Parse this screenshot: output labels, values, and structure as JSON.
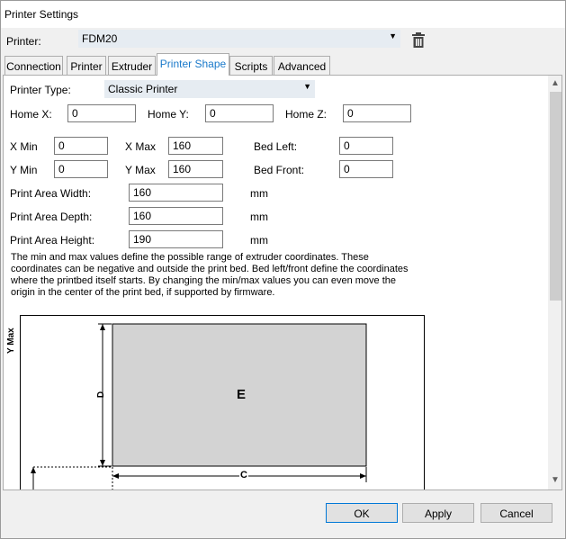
{
  "window": {
    "title": "Printer Settings"
  },
  "printer": {
    "label": "Printer:",
    "value": "FDM20"
  },
  "tabs": [
    "Connection",
    "Printer",
    "Extruder",
    "Printer Shape",
    "Scripts",
    "Advanced"
  ],
  "active_tab": "Printer Shape",
  "shape": {
    "printer_type_label": "Printer Type:",
    "printer_type_value": "Classic Printer",
    "home_x_label": "Home X:",
    "home_x": "0",
    "home_y_label": "Home Y:",
    "home_y": "0",
    "home_z_label": "Home Z:",
    "home_z": "0",
    "x_min_label": "X Min",
    "x_min": "0",
    "x_max_label": "X Max",
    "x_max": "160",
    "bed_left_label": "Bed Left:",
    "bed_left": "0",
    "y_min_label": "Y Min",
    "y_min": "0",
    "y_max_label": "Y Max",
    "y_max": "160",
    "bed_front_label": "Bed Front:",
    "bed_front": "0",
    "width_label": "Print Area Width:",
    "width": "160",
    "width_unit": "mm",
    "depth_label": "Print Area Depth:",
    "depth": "160",
    "depth_unit": "mm",
    "height_label": "Print Area Height:",
    "height": "190",
    "height_unit": "mm",
    "description": "The min and max values define the possible range of extruder coordinates. These coordinates can be negative and outside the print bed. Bed left/front define the coordinates where the printbed itself starts. By changing the min/max values you can even move the origin in the center of the print bed, if supported by firmware."
  },
  "diagram": {
    "y_max_label": "Y Max",
    "d_label": "D",
    "c_label": "C",
    "e_label": "E"
  },
  "buttons": {
    "ok": "OK",
    "apply": "Apply",
    "cancel": "Cancel"
  },
  "icons": {
    "delete": "trash-icon",
    "dropdown": "chevron-down-icon"
  },
  "colors": {
    "active_tab": "#1979ca",
    "bed_fill": "#d3d3d3",
    "combo_bg": "#e6ecf2"
  }
}
